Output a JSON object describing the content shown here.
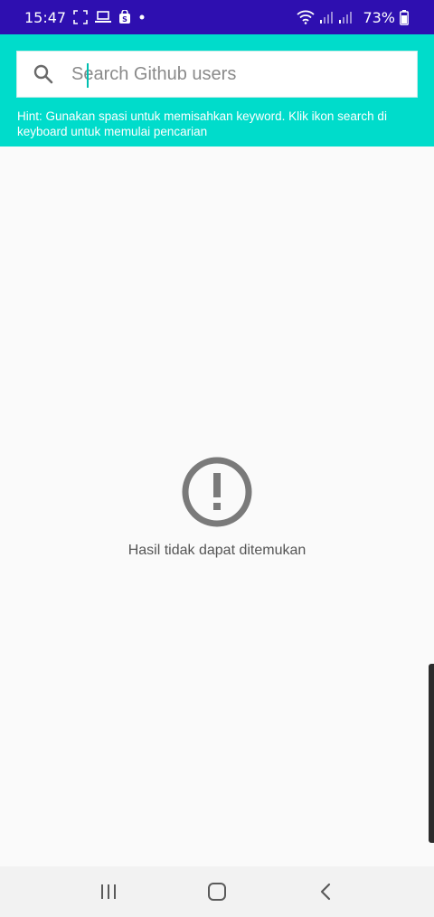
{
  "status_bar": {
    "time": "15:47",
    "battery_percent": "73%",
    "icons": [
      "screenshot-frame-icon",
      "laptop-icon",
      "shop-bag-icon",
      "dot-icon",
      "wifi-icon",
      "signal-icon",
      "signal-icon",
      "battery-icon"
    ]
  },
  "search": {
    "placeholder": "Search Github users",
    "value": "",
    "icon": "search-icon"
  },
  "hint": {
    "text": "Hint: Gunakan spasi untuk memisahkan keyword. Klik ikon search di keyboard untuk memulai pencarian"
  },
  "empty_state": {
    "icon": "alert-circle-icon",
    "message": "Hasil tidak dapat ditemukan"
  },
  "navigation": {
    "buttons": [
      "recent-apps-icon",
      "home-icon",
      "back-icon"
    ]
  },
  "colors": {
    "status_bar": "#2e0fb0",
    "header": "#00dccb",
    "background": "#fafafa",
    "icon_gray": "#7a7a7a"
  }
}
